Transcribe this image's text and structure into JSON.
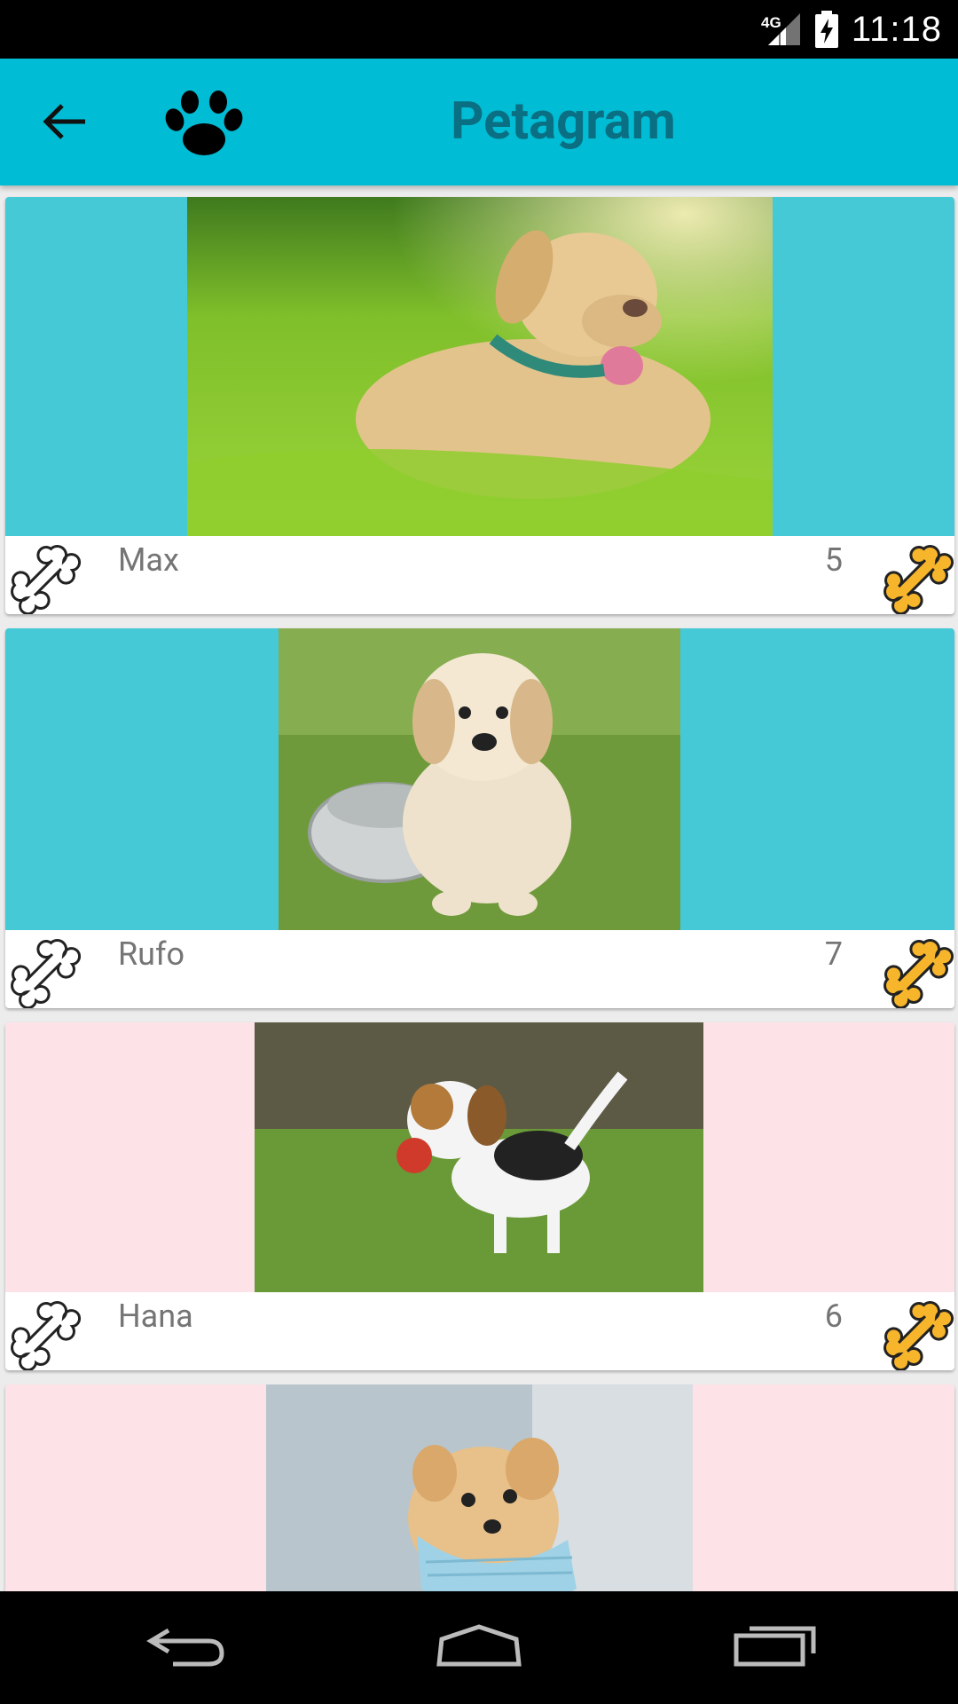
{
  "status_bar": {
    "network": "4G",
    "time": "11:18"
  },
  "app_bar": {
    "title": "Petagram",
    "back_icon": "arrow-back-icon",
    "logo_icon": "paw-icon",
    "color": "#00BCD4"
  },
  "pets": [
    {
      "name": "Max",
      "likes": "5",
      "background": "#45C9D6"
    },
    {
      "name": "Rufo",
      "likes": "7",
      "background": "#45C9D6"
    },
    {
      "name": "Hana",
      "likes": "6",
      "background": "#FDE2E8"
    },
    {
      "name": "",
      "likes": "",
      "background": "#FDE2E8"
    }
  ],
  "navigation": {
    "back": "nav-back-icon",
    "home": "nav-home-icon",
    "recents": "nav-recents-icon"
  }
}
